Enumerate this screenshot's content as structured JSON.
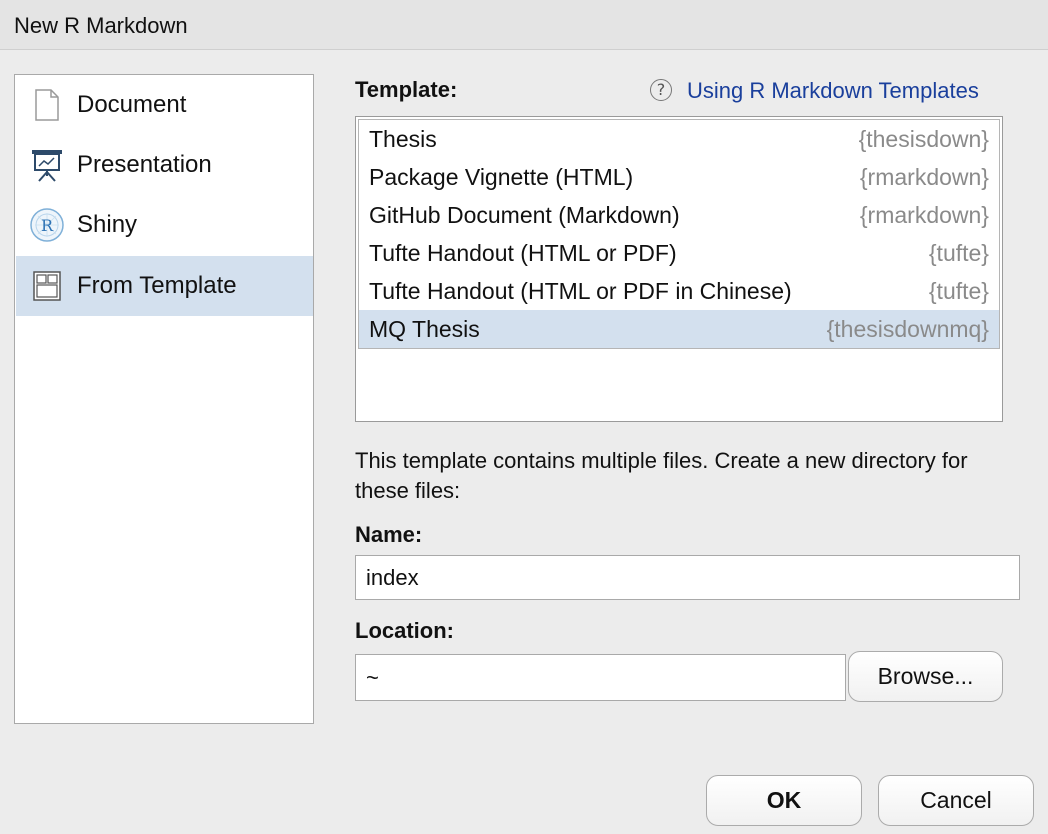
{
  "window": {
    "title": "New R Markdown"
  },
  "sidebar": {
    "items": [
      {
        "label": "Document",
        "icon": "document-icon",
        "selected": false
      },
      {
        "label": "Presentation",
        "icon": "presentation-icon",
        "selected": false
      },
      {
        "label": "Shiny",
        "icon": "shiny-icon",
        "selected": false
      },
      {
        "label": "From Template",
        "icon": "template-icon",
        "selected": true
      }
    ]
  },
  "template": {
    "heading": "Template:",
    "help_link": "Using R Markdown Templates",
    "items": [
      {
        "name": "Thesis",
        "package": "{thesisdown}",
        "selected": false
      },
      {
        "name": "Package Vignette (HTML)",
        "package": "{rmarkdown}",
        "selected": false
      },
      {
        "name": "GitHub Document (Markdown)",
        "package": "{rmarkdown}",
        "selected": false
      },
      {
        "name": "Tufte Handout (HTML or PDF)",
        "package": "{tufte}",
        "selected": false
      },
      {
        "name": "Tufte Handout (HTML or PDF in Chinese)",
        "package": "{tufte}",
        "selected": false
      },
      {
        "name": "MQ Thesis",
        "package": "{thesisdownmq}",
        "selected": true
      }
    ]
  },
  "description": "This template contains multiple files. Create a new directory for these files:",
  "name_field": {
    "label": "Name:",
    "value": "index"
  },
  "location_field": {
    "label": "Location:",
    "value": "~",
    "browse_label": "Browse..."
  },
  "buttons": {
    "ok": "OK",
    "cancel": "Cancel"
  },
  "colors": {
    "selection": "#d3e0ee",
    "link": "#1a3f9c",
    "package_text": "#8a8a8a"
  }
}
